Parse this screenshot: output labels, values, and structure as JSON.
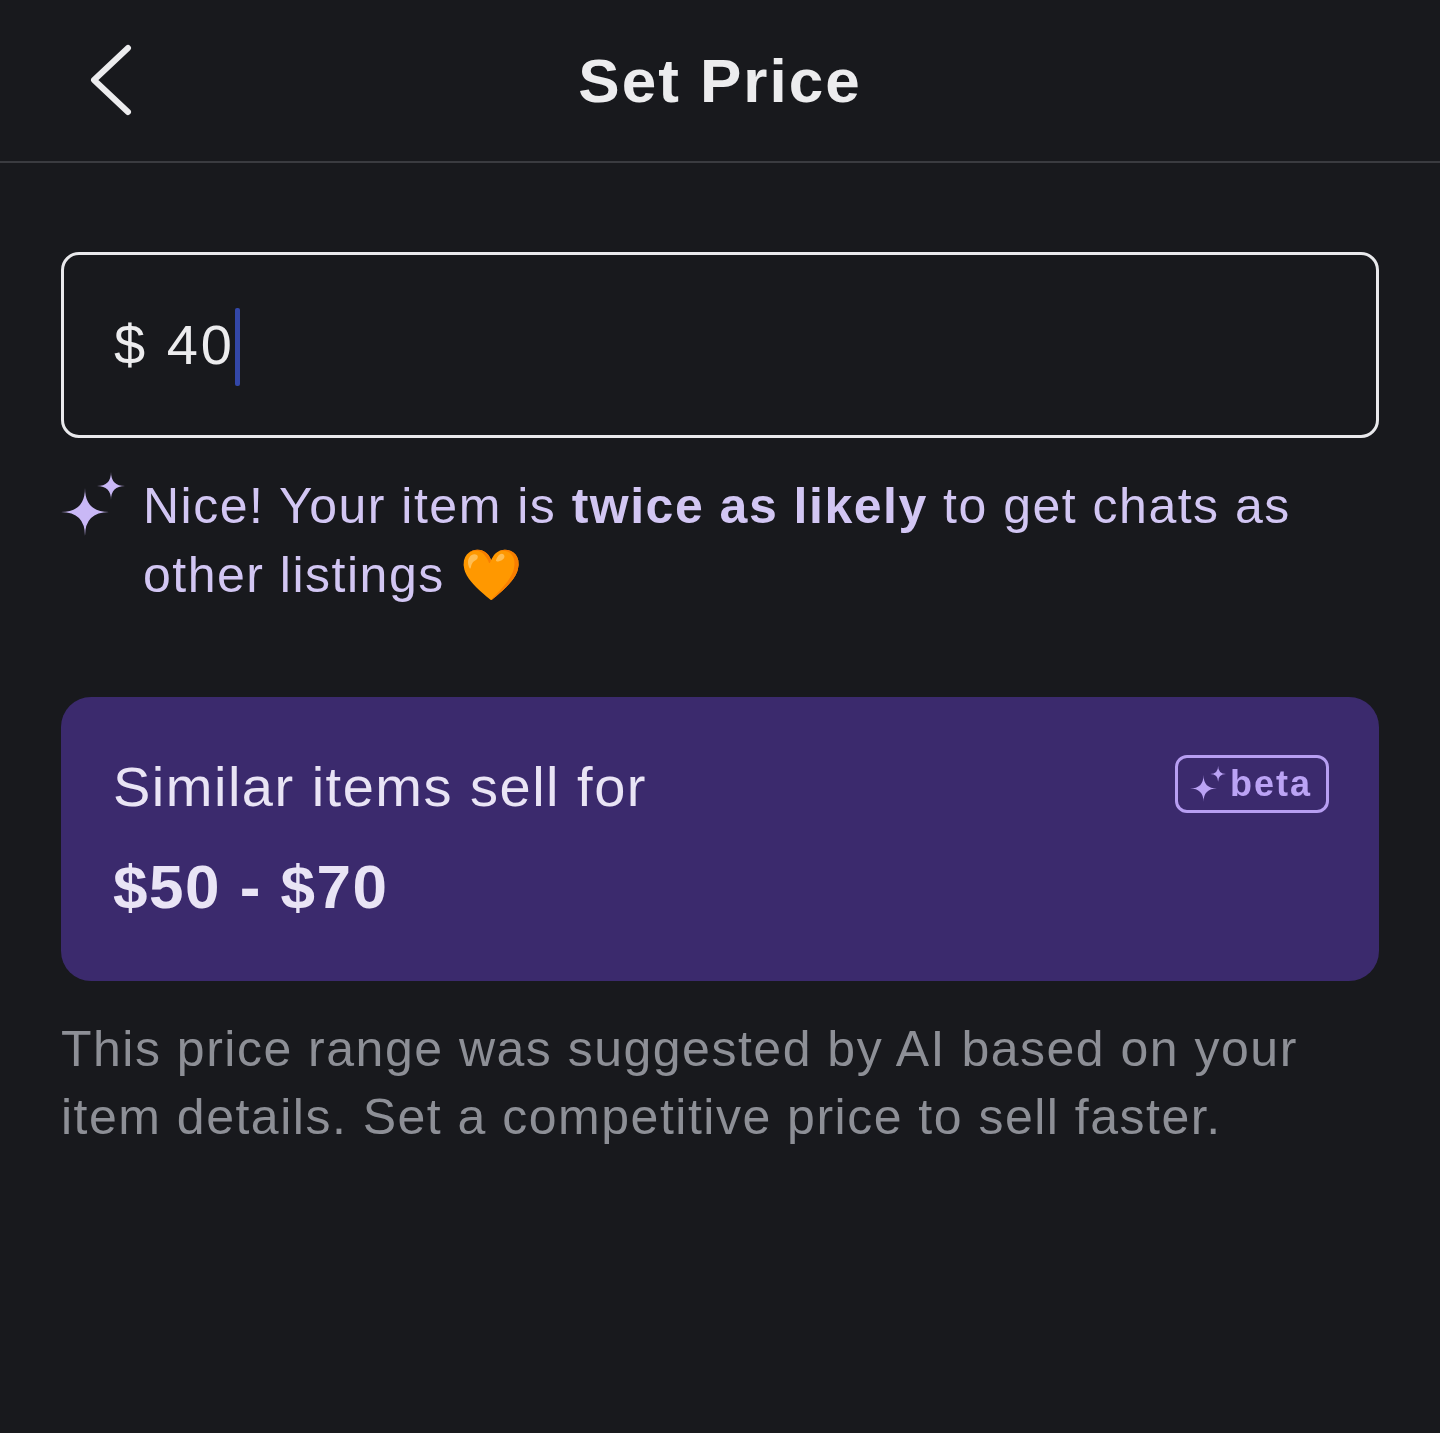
{
  "header": {
    "title": "Set Price"
  },
  "price_field": {
    "value": "$ 40",
    "focused": true
  },
  "hint": {
    "text": "Nice! Your item is **twice as likely** to get chats as other listings 🧡"
  },
  "suggestion_card": {
    "label": "Similar items sell for",
    "range": "$50 - $70",
    "badge": "beta"
  },
  "footnote": "This price range was suggested by AI based on your item details. Set a competitive price to sell faster."
}
